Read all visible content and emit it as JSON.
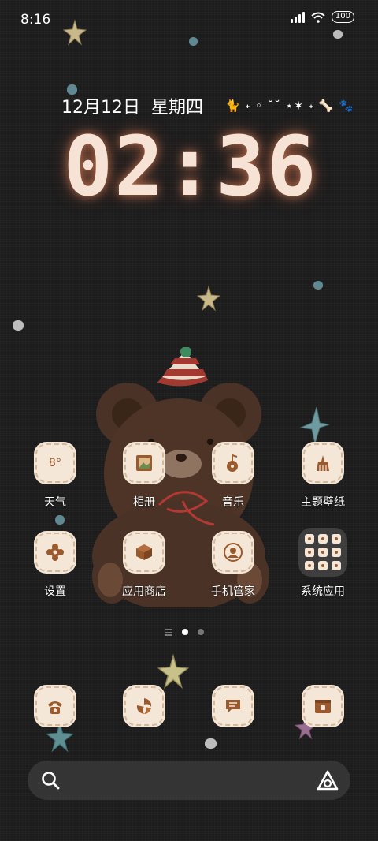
{
  "status_bar": {
    "time": "8:16",
    "battery": "100"
  },
  "lockclock": {
    "date": "12月12日",
    "weekday": "星期四",
    "decoration": "🐈 ˖ ◦ ˘˘ ⋆✶ ˖ 🦴 🐾",
    "time": "02:36"
  },
  "apps": [
    {
      "label": "天气",
      "icon": "weather-icon",
      "badge": "8°"
    },
    {
      "label": "相册",
      "icon": "gallery-icon"
    },
    {
      "label": "音乐",
      "icon": "music-icon"
    },
    {
      "label": "主题壁纸",
      "icon": "themes-icon"
    },
    {
      "label": "设置",
      "icon": "settings-icon"
    },
    {
      "label": "应用商店",
      "icon": "app-store-icon"
    },
    {
      "label": "手机管家",
      "icon": "security-icon"
    },
    {
      "label": "系统应用",
      "icon": "folder-icon"
    }
  ],
  "dock": [
    {
      "icon": "phone-icon"
    },
    {
      "icon": "browser-icon"
    },
    {
      "icon": "messages-icon"
    },
    {
      "icon": "camera-icon"
    }
  ],
  "page_indicator": {
    "pages": 2,
    "active": 1
  },
  "search_bar": {
    "icons": [
      "search-icon",
      "assistant-icon"
    ]
  },
  "colors": {
    "icon_bg": "#f4e7d8",
    "icon_glyph": "#9b5a2e",
    "clock_glow": "#ff9a66"
  }
}
